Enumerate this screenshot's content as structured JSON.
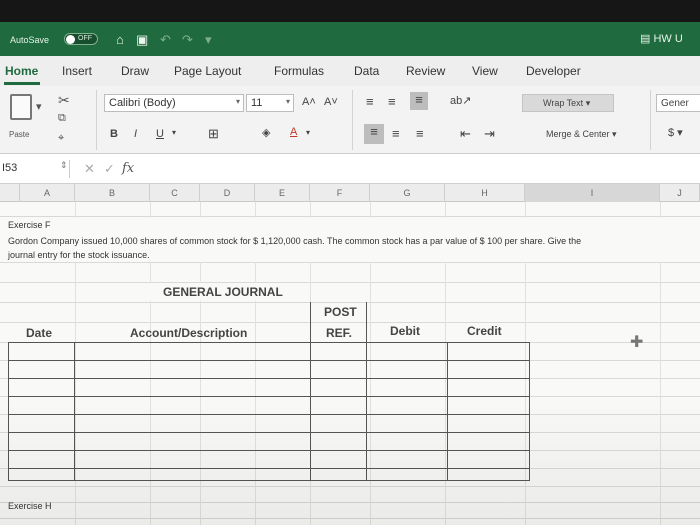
{
  "titlebar": {
    "autosave_label": "AutoSave",
    "autosave_state": "OFF",
    "window_title": "HW U"
  },
  "tabs": [
    "Home",
    "Insert",
    "Draw",
    "Page Layout",
    "Formulas",
    "Data",
    "Review",
    "View",
    "Developer"
  ],
  "ribbon": {
    "paste_label": "Paste",
    "font_name": "Calibri (Body)",
    "font_size": "11",
    "wrap_text": "Wrap Text",
    "merge_center": "Merge & Center",
    "number_format": "Gener",
    "currency_symbol": "$"
  },
  "formula_bar": {
    "name_box": "I53",
    "fx": "fx"
  },
  "columns": [
    "A",
    "B",
    "C",
    "D",
    "E",
    "F",
    "G",
    "H",
    "I",
    "J"
  ],
  "sheet": {
    "exercise_f": "Exercise F",
    "problem_line1": "Gordon Company issued 10,000 shares of common stock for $ 1,120,000 cash. The common stock has a par value of $ 100 per share. Give the",
    "problem_line2": "journal entry for the stock issuance.",
    "journal_title": "GENERAL JOURNAL",
    "post_label": "POST",
    "col_date": "Date",
    "col_account": "Account/Description",
    "col_ref": "REF.",
    "col_debit": "Debit",
    "col_credit": "Credit",
    "exercise_h": "Exercise H"
  },
  "colors": {
    "excel_green": "#1f6b3f"
  }
}
